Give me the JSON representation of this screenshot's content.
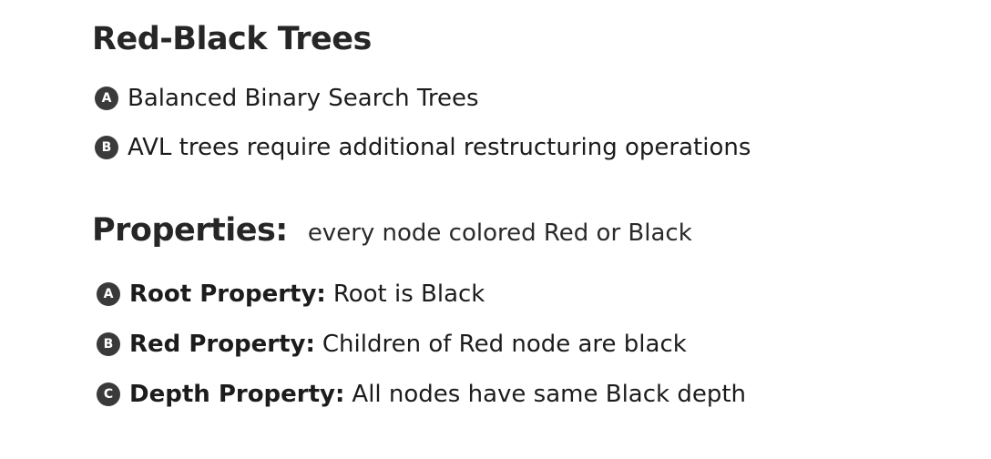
{
  "title": "Red-Black Trees",
  "intro_bullets": [
    {
      "marker": "A",
      "text": "Balanced Binary Search Trees"
    },
    {
      "marker": "B",
      "text": "AVL trees require additional restructuring operations"
    }
  ],
  "properties": {
    "heading": "Properties:",
    "subheading": "every node colored Red or Black",
    "items": [
      {
        "marker": "A",
        "label": "Root Property:",
        "text": "Root is Black"
      },
      {
        "marker": "B",
        "label": "Red Property:",
        "text": "Children of Red node are black"
      },
      {
        "marker": "C",
        "label": "Depth Property:",
        "text": "All nodes have same Black depth"
      }
    ]
  }
}
